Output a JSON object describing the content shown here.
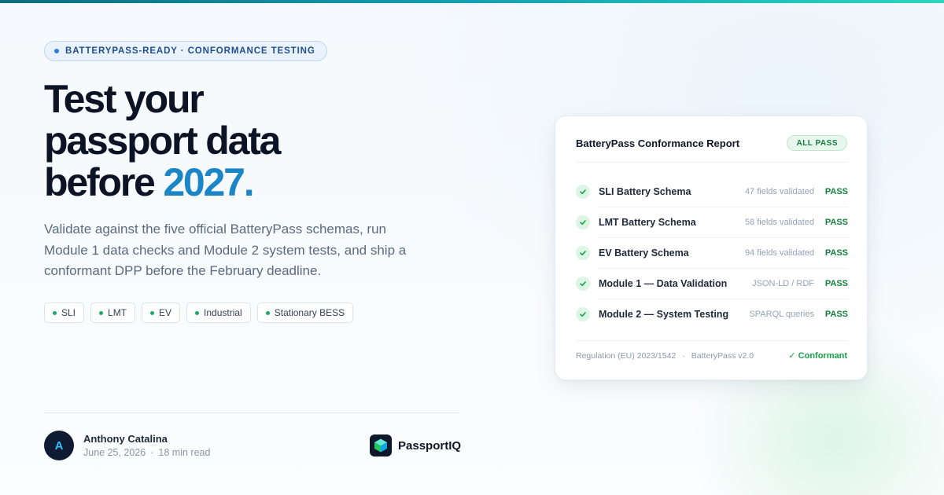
{
  "eyebrow": "BATTERYPASS-READY · CONFORMANCE TESTING",
  "headline": {
    "line1": "Test your",
    "line2": "passport data",
    "line3_pre": "before ",
    "line3_highlight": "2027."
  },
  "lede": "Validate against the five official BatteryPass schemas, run Module 1 data checks and Module 2 system tests, and ship a conformant DPP before the February deadline.",
  "tags": [
    "SLI",
    "LMT",
    "EV",
    "Industrial",
    "Stationary BESS"
  ],
  "author": {
    "initial": "A",
    "name": "Anthony Catalina",
    "date": "June 25, 2026",
    "separator": "·",
    "read_time": "18 min read"
  },
  "brand": {
    "name": "PassportIQ"
  },
  "report": {
    "title": "BatteryPass Conformance Report",
    "badge": "ALL PASS",
    "rows": [
      {
        "name": "SLI Battery Schema",
        "meta": "47 fields validated",
        "status": "PASS"
      },
      {
        "name": "LMT Battery Schema",
        "meta": "58 fields validated",
        "status": "PASS"
      },
      {
        "name": "EV Battery Schema",
        "meta": "94 fields validated",
        "status": "PASS"
      },
      {
        "name": "Module 1 — Data Validation",
        "meta": "JSON-LD / RDF",
        "status": "PASS"
      },
      {
        "name": "Module 2 — System Testing",
        "meta": "SPARQL queries",
        "status": "PASS"
      }
    ],
    "footer": {
      "regulation": "Regulation (EU) 2023/1542",
      "separator": "·",
      "version": "BatteryPass v2.0",
      "result": "✓ Conformant"
    }
  },
  "colors": {
    "accent": "#1a86c7",
    "pass": "#15803d",
    "tag_dot": "#1aa968"
  }
}
